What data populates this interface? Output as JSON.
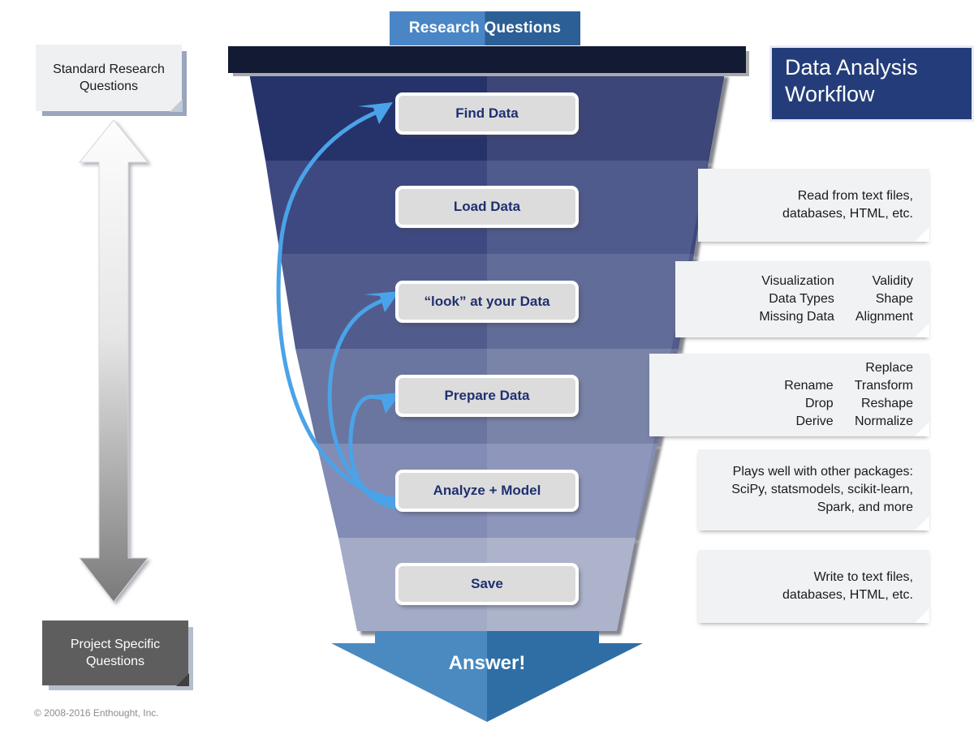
{
  "header": {
    "tab_label_left": "Research",
    "tab_label_right": "Questions",
    "tab_label": "Research Questions"
  },
  "title": {
    "line1": "Data Analysis",
    "line2": "Workflow",
    "bg_color": "#243d7a"
  },
  "sidebar": {
    "top_note": "Standard Research Questions",
    "top_note_line1": "Standard Research",
    "top_note_line2": "Questions",
    "bottom_note": "Project Specific Questions",
    "bottom_note_line1": "Project Specific",
    "bottom_note_line2": "Questions",
    "arrow_name": "double-headed-vertical-arrow",
    "arrow_gradient_from": "#fdfdfd",
    "arrow_gradient_to": "#7b7b7b"
  },
  "funnel": {
    "stages": [
      {
        "label": "Find Data",
        "color": "#25306b"
      },
      {
        "label": "Load Data",
        "color": "#3d4880"
      },
      {
        "label": "“look” at your Data",
        "color": "#515c8d"
      },
      {
        "label": "Prepare Data",
        "color": "#6b769f"
      },
      {
        "label": "Analyze + Model",
        "color": "#828cb4"
      },
      {
        "label": "Save",
        "color": "#a3abc6"
      }
    ],
    "top_bar_color": "#131a33"
  },
  "callouts": [
    {
      "stage": "Load Data",
      "lines": [
        "Read from text files,",
        "databases, HTML, etc."
      ]
    },
    {
      "stage": "look at your Data",
      "columns": [
        [
          "Visualization",
          "Data Types",
          "Missing Data"
        ],
        [
          "Validity",
          "Shape",
          "Alignment"
        ]
      ]
    },
    {
      "stage": "Prepare Data",
      "columns": [
        [
          "Rename",
          "Drop",
          "Derive"
        ],
        [
          "Replace",
          "Transform",
          "Reshape",
          "Normalize"
        ]
      ]
    },
    {
      "stage": "Analyze + Model",
      "lines": [
        "Plays well with other packages:",
        "SciPy, statsmodels, scikit-learn,",
        "Spark, and more"
      ]
    },
    {
      "stage": "Save",
      "lines": [
        "Write to text files,",
        "databases, HTML, etc."
      ]
    }
  ],
  "answer": {
    "label": "Answer!",
    "color_left": "#4a8ac0",
    "color_right": "#2f6ea5"
  },
  "feedback_arrows": {
    "name": "iteration-feedback-arrows",
    "color": "#4aa3e8",
    "targets": [
      "Find Data",
      "“look” at your Data",
      "Prepare Data"
    ],
    "source": "Analyze + Model"
  },
  "footer": {
    "copyright": "© 2008-2016 Enthought, Inc."
  }
}
